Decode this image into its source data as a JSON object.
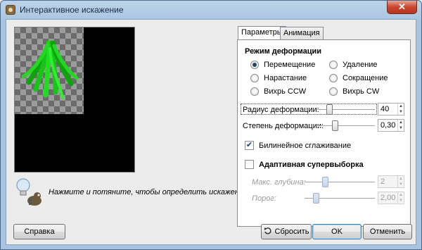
{
  "window": {
    "title": "Интерактивное искажение",
    "close_glyph": "✕"
  },
  "hint": {
    "text": "Нажмите и потяните, чтобы определить искажение."
  },
  "tabs": [
    {
      "label": "Параметры",
      "active": true
    },
    {
      "label": "Анимация",
      "active": false
    }
  ],
  "deformation_mode": {
    "title": "Режим деформации",
    "options": [
      {
        "label": "Перемещение",
        "checked": true
      },
      {
        "label": "Удаление",
        "checked": false
      },
      {
        "label": "Нарастание",
        "checked": false
      },
      {
        "label": "Сокращение",
        "checked": false
      },
      {
        "label": "Вихрь CCW",
        "checked": false
      },
      {
        "label": "Вихрь CW",
        "checked": false
      }
    ]
  },
  "radius": {
    "label": "Радиус деформации:",
    "value": "40"
  },
  "strength": {
    "label": "Степень деформации:",
    "value": "0,30"
  },
  "bilinear": {
    "label": "Билинейное сглаживание",
    "checked": true
  },
  "adaptive": {
    "label": "Адаптивная супервыборка",
    "checked": false
  },
  "max_depth": {
    "label": "Макс. глубина:",
    "value": "2"
  },
  "threshold": {
    "label": "Порог:",
    "value": "2,00"
  },
  "buttons": {
    "help": "Справка",
    "reset": "Сбросить",
    "ok": "OK",
    "cancel": "Отменить"
  },
  "colors": {
    "accent_green": "#1fd11f",
    "titlebar": "#a9c4e0",
    "close_red": "#c8452f"
  }
}
